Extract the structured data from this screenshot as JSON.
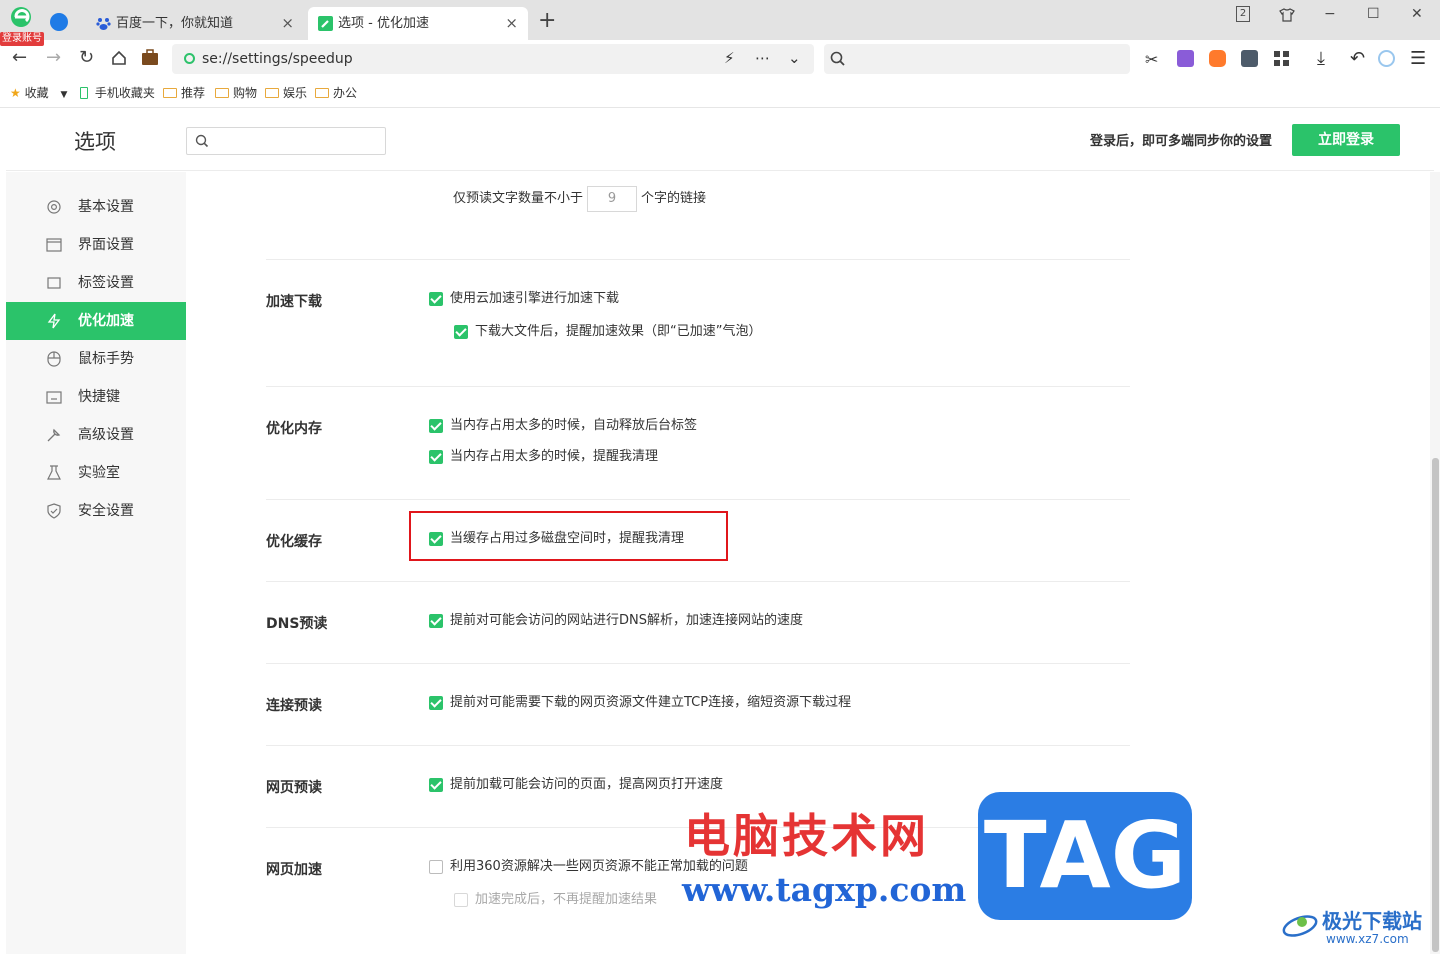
{
  "browser": {
    "login_badge": "登录账号",
    "tabs": [
      {
        "title": "百度一下，你就知道"
      },
      {
        "title": "选项 - 优化加速"
      }
    ],
    "new_tab": "+",
    "close_glyph": "×",
    "window_controls": {
      "tab_count": "2",
      "minimize": "−",
      "maximize": "☐",
      "close": "✕"
    },
    "address": {
      "url": "se://settings/speedup"
    },
    "bookmarks": [
      {
        "label": "收藏",
        "icon": "star-icon"
      },
      {
        "label": "手机收藏夹",
        "icon": "phone-icon"
      },
      {
        "label": "推荐",
        "icon": "folder-icon"
      },
      {
        "label": "购物",
        "icon": "folder-icon"
      },
      {
        "label": "娱乐",
        "icon": "folder-icon"
      },
      {
        "label": "办公",
        "icon": "folder-icon"
      }
    ]
  },
  "header": {
    "title": "选项",
    "sync_text": "登录后，即可多端同步你的设置",
    "login_button": "立即登录"
  },
  "sidebar": {
    "items": [
      {
        "label": "基本设置",
        "icon": "gear-icon"
      },
      {
        "label": "界面设置",
        "icon": "window-icon"
      },
      {
        "label": "标签设置",
        "icon": "tab-icon"
      },
      {
        "label": "优化加速",
        "icon": "lightning-icon",
        "active": true
      },
      {
        "label": "鼠标手势",
        "icon": "mouse-icon"
      },
      {
        "label": "快捷键",
        "icon": "keyboard-icon"
      },
      {
        "label": "高级设置",
        "icon": "wrench-icon"
      },
      {
        "label": "实验室",
        "icon": "flask-icon"
      },
      {
        "label": "安全设置",
        "icon": "shield-icon"
      }
    ]
  },
  "content": {
    "preread_prefix": "仅预读文字数量不小于",
    "preread_value": "9",
    "preread_suffix": "个字的链接",
    "sections": [
      {
        "label": "加速下载",
        "options": [
          {
            "text": "使用云加速引擎进行加速下载",
            "checked": true
          },
          {
            "text": "下载大文件后，提醒加速效果（即“已加速”气泡）",
            "checked": true
          }
        ]
      },
      {
        "label": "优化内存",
        "options": [
          {
            "text": "当内存占用太多的时候，自动释放后台标签",
            "checked": true
          },
          {
            "text": "当内存占用太多的时候，提醒我清理",
            "checked": true
          }
        ]
      },
      {
        "label": "优化缓存",
        "options": [
          {
            "text": "当缓存占用过多磁盘空间时，提醒我清理",
            "checked": true
          }
        ]
      },
      {
        "label": "DNS预读",
        "options": [
          {
            "text": "提前对可能会访问的网站进行DNS解析，加速连接网站的速度",
            "checked": true
          }
        ]
      },
      {
        "label": "连接预读",
        "options": [
          {
            "text": "提前对可能需要下载的网页资源文件建立TCP连接，缩短资源下载过程",
            "checked": true
          }
        ]
      },
      {
        "label": "网页预读",
        "options": [
          {
            "text": "提前加载可能会访问的页面，提高网页打开速度",
            "checked": true
          }
        ]
      },
      {
        "label": "网页加速",
        "options": [
          {
            "text": "利用360资源解决一些网页资源不能正常加载的问题",
            "checked": false
          },
          {
            "text": "加速完成后，不再提醒加速结果",
            "checked": false
          }
        ]
      }
    ]
  },
  "watermark": {
    "site_cn": "电脑技术网",
    "site_url": "www.tagxp.com",
    "tag": "TAG",
    "jiguang": "极光下载站",
    "jiguang_url": "www.xz7.com"
  },
  "colors": {
    "accent": "#2bc36a",
    "highlight_border": "#e0161b"
  }
}
